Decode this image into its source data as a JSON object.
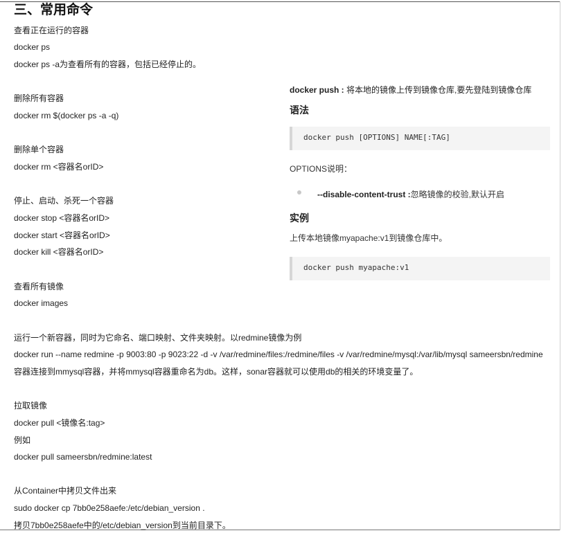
{
  "section_title": "三、常用命令",
  "lines": [
    "查看正在运行的容器",
    "docker ps",
    "docker ps -a为查看所有的容器，包括已经停止的。",
    "删除所有容器",
    "docker rm $(docker ps -a -q)",
    "删除单个容器",
    "docker rm <容器名orID>",
    "停止、启动、杀死一个容器",
    "docker stop <容器名orID>",
    "docker start <容器名orID>",
    "docker kill <容器名orID>",
    "查看所有镜像",
    "docker images",
    "运行一个新容器，同时为它命名、端口映射、文件夹映射。以redmine镜像为例",
    "docker run --name redmine -p 9003:80 -p 9023:22 -d -v /var/redmine/files:/redmine/files -v /var/redmine/mysql:/var/lib/mysql sameersbn/redmine",
    "容器连接到mmysql容器，并将mmysql容器重命名为db。这样，sonar容器就可以使用db的相关的环境变量了。",
    "拉取镜像",
    "docker pull <镜像名:tag>",
    "例如",
    "docker pull sameersbn/redmine:latest",
    "从Container中拷贝文件出来",
    "sudo docker cp 7bb0e258aefe:/etc/debian_version .",
    "拷贝7bb0e258aefe中的/etc/debian_version到当前目录下。"
  ],
  "panel": {
    "intro_cmd": "docker push :",
    "intro_desc": " 将本地的镜像上传到镜像仓库,要先登陆到镜像仓库",
    "syntax_heading": "语法",
    "syntax_code": "docker push [OPTIONS] NAME[:TAG]",
    "options_label": "OPTIONS说明：",
    "option_flag": "--disable-content-trust :",
    "option_desc": "忽略镜像的校验,默认开启",
    "example_heading": "实例",
    "example_text": "上传本地镜像myapache:v1到镜像仓库中。",
    "example_code": "docker push myapache:v1"
  }
}
